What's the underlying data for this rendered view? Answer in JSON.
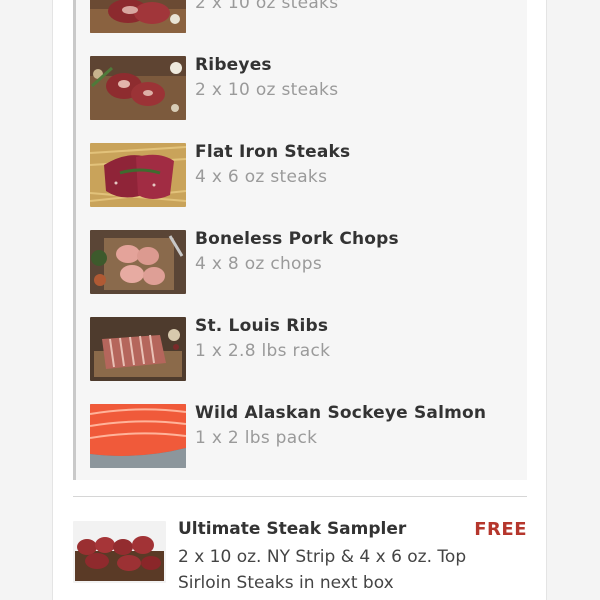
{
  "order_items": [
    {
      "name": "",
      "qty": "2 x 10 oz steaks",
      "icon": "steak-image"
    },
    {
      "name": "Ribeyes",
      "qty": "2 x 10 oz steaks",
      "icon": "ribeye-image"
    },
    {
      "name": "Flat Iron Steaks",
      "qty": "4 x 6 oz steaks",
      "icon": "flat-iron-steak-image"
    },
    {
      "name": "Boneless Pork Chops",
      "qty": "4 x 8 oz chops",
      "icon": "pork-chop-image"
    },
    {
      "name": "St. Louis Ribs",
      "qty": "1 x 2.8 lbs rack",
      "icon": "ribs-image"
    },
    {
      "name": "Wild Alaskan Sockeye Salmon",
      "qty": "1 x 2 lbs pack",
      "icon": "salmon-image"
    }
  ],
  "promo": {
    "name": "Ultimate Steak Sampler",
    "desc": "2 x 10 oz. NY Strip & 4 x 6 oz. Top Sirloin Steaks in next box",
    "price": "FREE",
    "icon": "steak-sampler-image"
  },
  "colors": {
    "accent_price": "#b5362c",
    "title_text": "#333333",
    "subtle_text": "#9a9a9a"
  }
}
